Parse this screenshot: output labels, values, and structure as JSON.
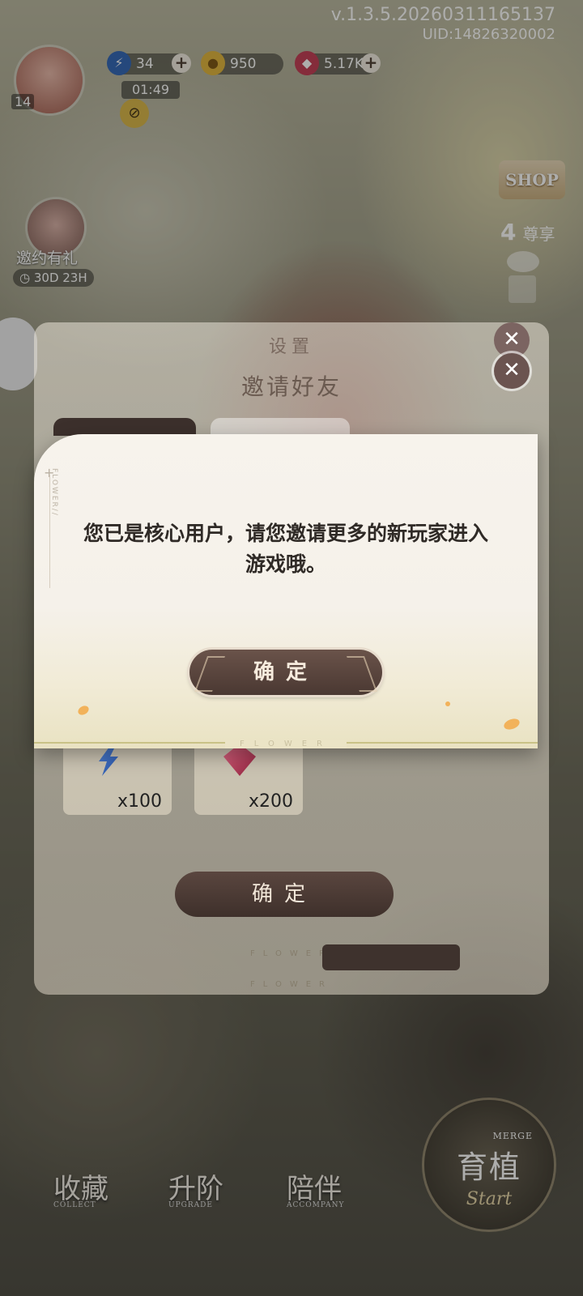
{
  "version": {
    "build": "v.1.3.5.20260311165137",
    "uid": "UID:14826320002"
  },
  "hud": {
    "level": "14",
    "energy": "34",
    "gold": "950",
    "gems": "5.17K",
    "timer": "01:49"
  },
  "right_rail": {
    "shop_label": "SHOP",
    "vip_count": "4",
    "vip_label": "尊享"
  },
  "left_rail": {
    "invite_gift_label": "邀约有礼",
    "invite_gift_timer": "30D 23H"
  },
  "settings_panel": {
    "title": "设置",
    "subtitle": "邀请好友",
    "rewards": [
      {
        "qty": "x100",
        "icon": "energy-icon"
      },
      {
        "qty": "x200",
        "icon": "gem-icon"
      }
    ],
    "confirm_label": "确定",
    "deco_word": "FLOWER"
  },
  "dialog": {
    "side_word": "FLOWER//",
    "message": "您已是核心用户，请您邀请更多的新玩家进入游戏哦。",
    "ok_label": "确定",
    "bottom_word": "FLOWER"
  },
  "bottom_nav": {
    "items": [
      {
        "label": "收藏",
        "sub": "COLLECT"
      },
      {
        "label": "升阶",
        "sub": "UPGRADE"
      },
      {
        "label": "陪伴",
        "sub": "ACCOMPANY"
      }
    ],
    "start_title": "育植",
    "start_merge": "MERGE",
    "start_script": "Start"
  },
  "colors": {
    "accent": "#4a3832",
    "dialog_bg": "#f7f3ec",
    "gold_line": "#c9c287"
  }
}
